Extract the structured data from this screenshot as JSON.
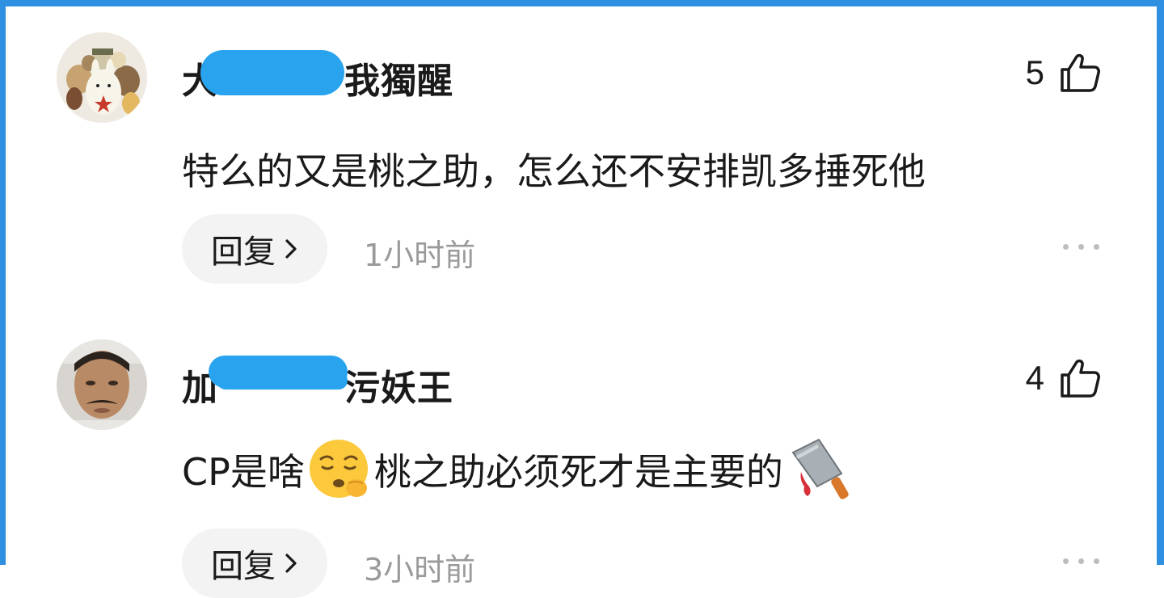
{
  "comments": [
    {
      "username_prefix": "大",
      "username_suffix": "我獨醒",
      "likes": "5",
      "text": "特么的又是桃之助，怎么还不安排凯多捶死他",
      "reply_label": "回复",
      "time": "1小时前",
      "avatar": "cartoon-group-avatar"
    },
    {
      "username_prefix": "加",
      "username_suffix": "污妖王",
      "likes": "4",
      "text_before": "CP是啥",
      "emoji1": "thinking-face-emoji",
      "text_after": "桃之助必须死才是主要的",
      "emoji2": "cleaver-knife-emoji",
      "reply_label": "回复",
      "time": "3小时前",
      "avatar": "man-photo-avatar"
    }
  ],
  "colors": {
    "frame": "#2f8fe0",
    "redaction": "#2aa3ee",
    "reply_bg": "#f3f3f3",
    "time_text": "#9a9a9a"
  }
}
